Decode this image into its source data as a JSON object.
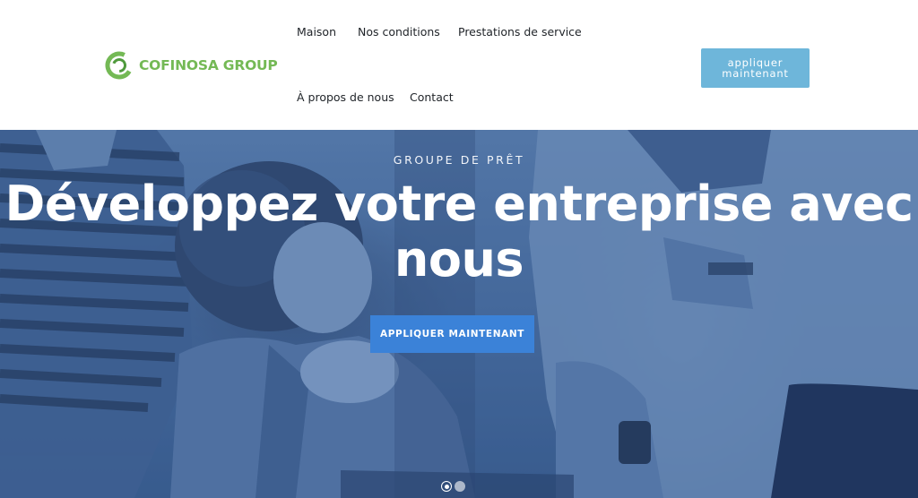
{
  "header": {
    "logo_text": "COFINOSA GROUP",
    "logo_icon": "cofinosa-ring-logo",
    "nav": {
      "maison": "Maison",
      "conditions": "Nos conditions",
      "prestations": "Prestations de service",
      "apropos": "À propos de nous",
      "contact": "Contact"
    },
    "cta_label": "appliquer maintenant"
  },
  "hero": {
    "overline": "GROUPE DE PRÊT",
    "title": "Développez votre entreprise avec nous",
    "cta_label": "APPLIQUER MAINTENANT",
    "slides_total": 2,
    "active_slide": 1
  },
  "colors": {
    "brand_green": "#74b955",
    "brand_green_dark": "#4f9a3c",
    "header_cta_bg": "#6eb6da",
    "hero_cta_bg": "#3b82d8",
    "hero_overlay": "#45699b"
  }
}
